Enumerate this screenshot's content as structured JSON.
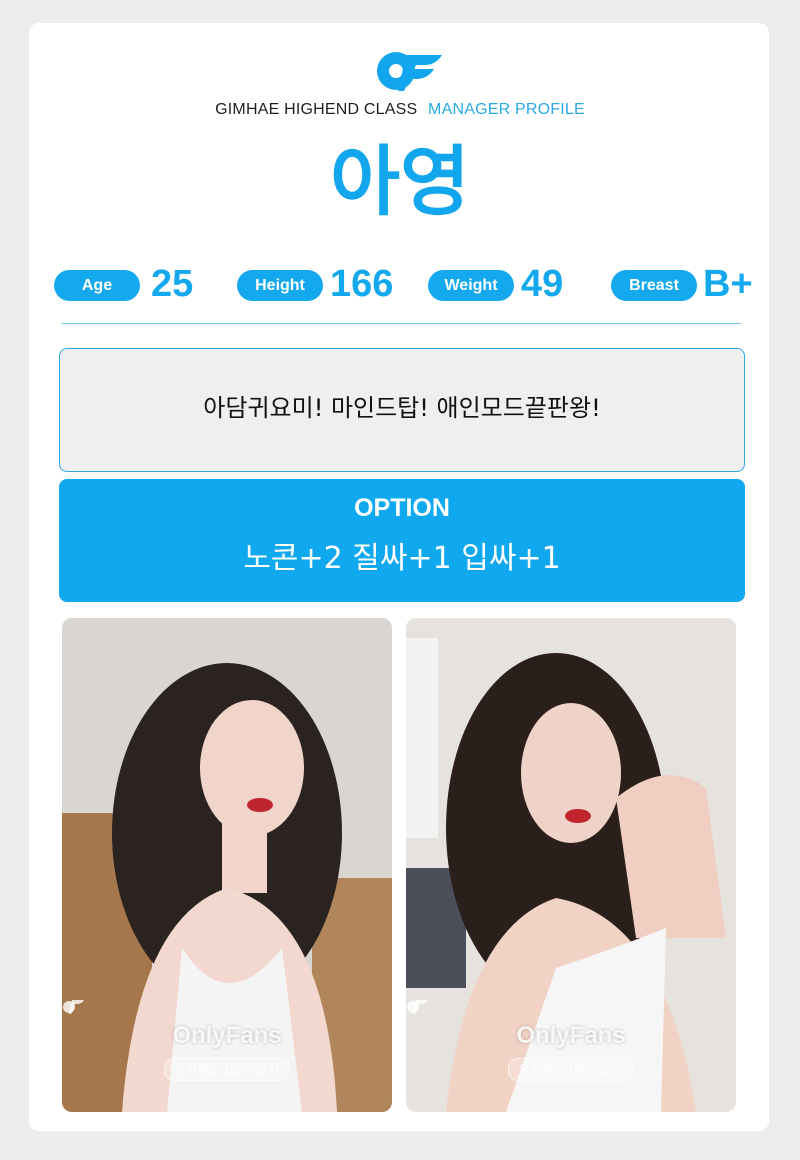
{
  "brand": {
    "dark_text": "GIMHAE HIGHEND CLASS",
    "light_text": "MANAGER PROFILE"
  },
  "profile": {
    "name": "아영"
  },
  "stats": [
    {
      "label": "Age",
      "value": "25"
    },
    {
      "label": "Height",
      "value": "166"
    },
    {
      "label": "Weight",
      "value": "49"
    },
    {
      "label": "Breast",
      "value": "B+"
    }
  ],
  "intro": {
    "text": "아담귀요미! 마인드탑! 애인모드끝판왕!"
  },
  "option": {
    "title": "OPTION",
    "text": "노콘+2 질싸+1 입싸+1"
  },
  "photos": [
    {
      "watermark_name": "OnlyFans",
      "watermark_sub": "온리팬스 100%실사"
    },
    {
      "watermark_name": "OnlyFans",
      "watermark_sub": "온리팬스 100%실사"
    }
  ],
  "colors": {
    "accent": "#12a6ee",
    "background": "#ececec",
    "card": "#ffffff",
    "intro_bg": "#efefef"
  },
  "icons": {
    "logo": "onlyfans-logo-icon",
    "watermark": "onlyfans-watermark-icon"
  }
}
